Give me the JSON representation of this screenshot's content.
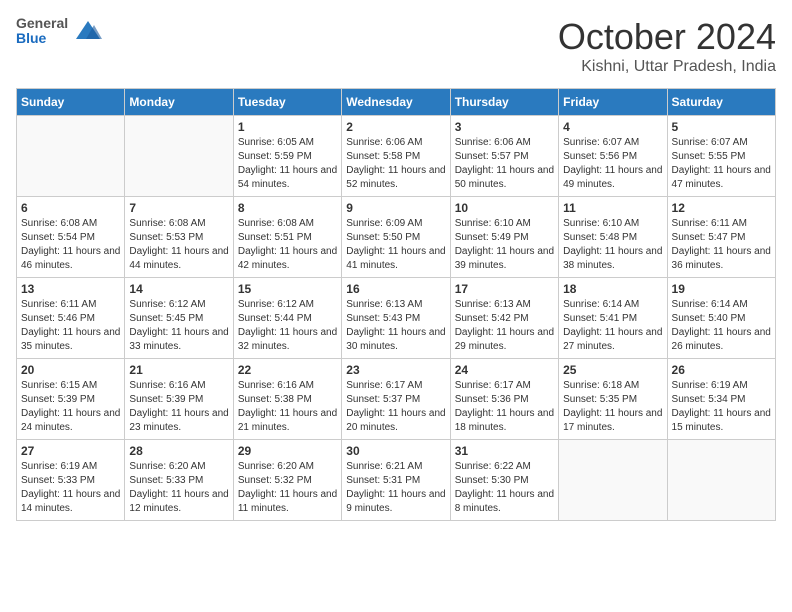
{
  "header": {
    "logo": {
      "general": "General",
      "blue": "Blue"
    },
    "title": "October 2024",
    "location": "Kishni, Uttar Pradesh, India"
  },
  "calendar": {
    "days_of_week": [
      "Sunday",
      "Monday",
      "Tuesday",
      "Wednesday",
      "Thursday",
      "Friday",
      "Saturday"
    ],
    "weeks": [
      [
        {
          "day": "",
          "info": ""
        },
        {
          "day": "",
          "info": ""
        },
        {
          "day": "1",
          "info": "Sunrise: 6:05 AM\nSunset: 5:59 PM\nDaylight: 11 hours and 54 minutes."
        },
        {
          "day": "2",
          "info": "Sunrise: 6:06 AM\nSunset: 5:58 PM\nDaylight: 11 hours and 52 minutes."
        },
        {
          "day": "3",
          "info": "Sunrise: 6:06 AM\nSunset: 5:57 PM\nDaylight: 11 hours and 50 minutes."
        },
        {
          "day": "4",
          "info": "Sunrise: 6:07 AM\nSunset: 5:56 PM\nDaylight: 11 hours and 49 minutes."
        },
        {
          "day": "5",
          "info": "Sunrise: 6:07 AM\nSunset: 5:55 PM\nDaylight: 11 hours and 47 minutes."
        }
      ],
      [
        {
          "day": "6",
          "info": "Sunrise: 6:08 AM\nSunset: 5:54 PM\nDaylight: 11 hours and 46 minutes."
        },
        {
          "day": "7",
          "info": "Sunrise: 6:08 AM\nSunset: 5:53 PM\nDaylight: 11 hours and 44 minutes."
        },
        {
          "day": "8",
          "info": "Sunrise: 6:08 AM\nSunset: 5:51 PM\nDaylight: 11 hours and 42 minutes."
        },
        {
          "day": "9",
          "info": "Sunrise: 6:09 AM\nSunset: 5:50 PM\nDaylight: 11 hours and 41 minutes."
        },
        {
          "day": "10",
          "info": "Sunrise: 6:10 AM\nSunset: 5:49 PM\nDaylight: 11 hours and 39 minutes."
        },
        {
          "day": "11",
          "info": "Sunrise: 6:10 AM\nSunset: 5:48 PM\nDaylight: 11 hours and 38 minutes."
        },
        {
          "day": "12",
          "info": "Sunrise: 6:11 AM\nSunset: 5:47 PM\nDaylight: 11 hours and 36 minutes."
        }
      ],
      [
        {
          "day": "13",
          "info": "Sunrise: 6:11 AM\nSunset: 5:46 PM\nDaylight: 11 hours and 35 minutes."
        },
        {
          "day": "14",
          "info": "Sunrise: 6:12 AM\nSunset: 5:45 PM\nDaylight: 11 hours and 33 minutes."
        },
        {
          "day": "15",
          "info": "Sunrise: 6:12 AM\nSunset: 5:44 PM\nDaylight: 11 hours and 32 minutes."
        },
        {
          "day": "16",
          "info": "Sunrise: 6:13 AM\nSunset: 5:43 PM\nDaylight: 11 hours and 30 minutes."
        },
        {
          "day": "17",
          "info": "Sunrise: 6:13 AM\nSunset: 5:42 PM\nDaylight: 11 hours and 29 minutes."
        },
        {
          "day": "18",
          "info": "Sunrise: 6:14 AM\nSunset: 5:41 PM\nDaylight: 11 hours and 27 minutes."
        },
        {
          "day": "19",
          "info": "Sunrise: 6:14 AM\nSunset: 5:40 PM\nDaylight: 11 hours and 26 minutes."
        }
      ],
      [
        {
          "day": "20",
          "info": "Sunrise: 6:15 AM\nSunset: 5:39 PM\nDaylight: 11 hours and 24 minutes."
        },
        {
          "day": "21",
          "info": "Sunrise: 6:16 AM\nSunset: 5:39 PM\nDaylight: 11 hours and 23 minutes."
        },
        {
          "day": "22",
          "info": "Sunrise: 6:16 AM\nSunset: 5:38 PM\nDaylight: 11 hours and 21 minutes."
        },
        {
          "day": "23",
          "info": "Sunrise: 6:17 AM\nSunset: 5:37 PM\nDaylight: 11 hours and 20 minutes."
        },
        {
          "day": "24",
          "info": "Sunrise: 6:17 AM\nSunset: 5:36 PM\nDaylight: 11 hours and 18 minutes."
        },
        {
          "day": "25",
          "info": "Sunrise: 6:18 AM\nSunset: 5:35 PM\nDaylight: 11 hours and 17 minutes."
        },
        {
          "day": "26",
          "info": "Sunrise: 6:19 AM\nSunset: 5:34 PM\nDaylight: 11 hours and 15 minutes."
        }
      ],
      [
        {
          "day": "27",
          "info": "Sunrise: 6:19 AM\nSunset: 5:33 PM\nDaylight: 11 hours and 14 minutes."
        },
        {
          "day": "28",
          "info": "Sunrise: 6:20 AM\nSunset: 5:33 PM\nDaylight: 11 hours and 12 minutes."
        },
        {
          "day": "29",
          "info": "Sunrise: 6:20 AM\nSunset: 5:32 PM\nDaylight: 11 hours and 11 minutes."
        },
        {
          "day": "30",
          "info": "Sunrise: 6:21 AM\nSunset: 5:31 PM\nDaylight: 11 hours and 9 minutes."
        },
        {
          "day": "31",
          "info": "Sunrise: 6:22 AM\nSunset: 5:30 PM\nDaylight: 11 hours and 8 minutes."
        },
        {
          "day": "",
          "info": ""
        },
        {
          "day": "",
          "info": ""
        }
      ]
    ]
  }
}
